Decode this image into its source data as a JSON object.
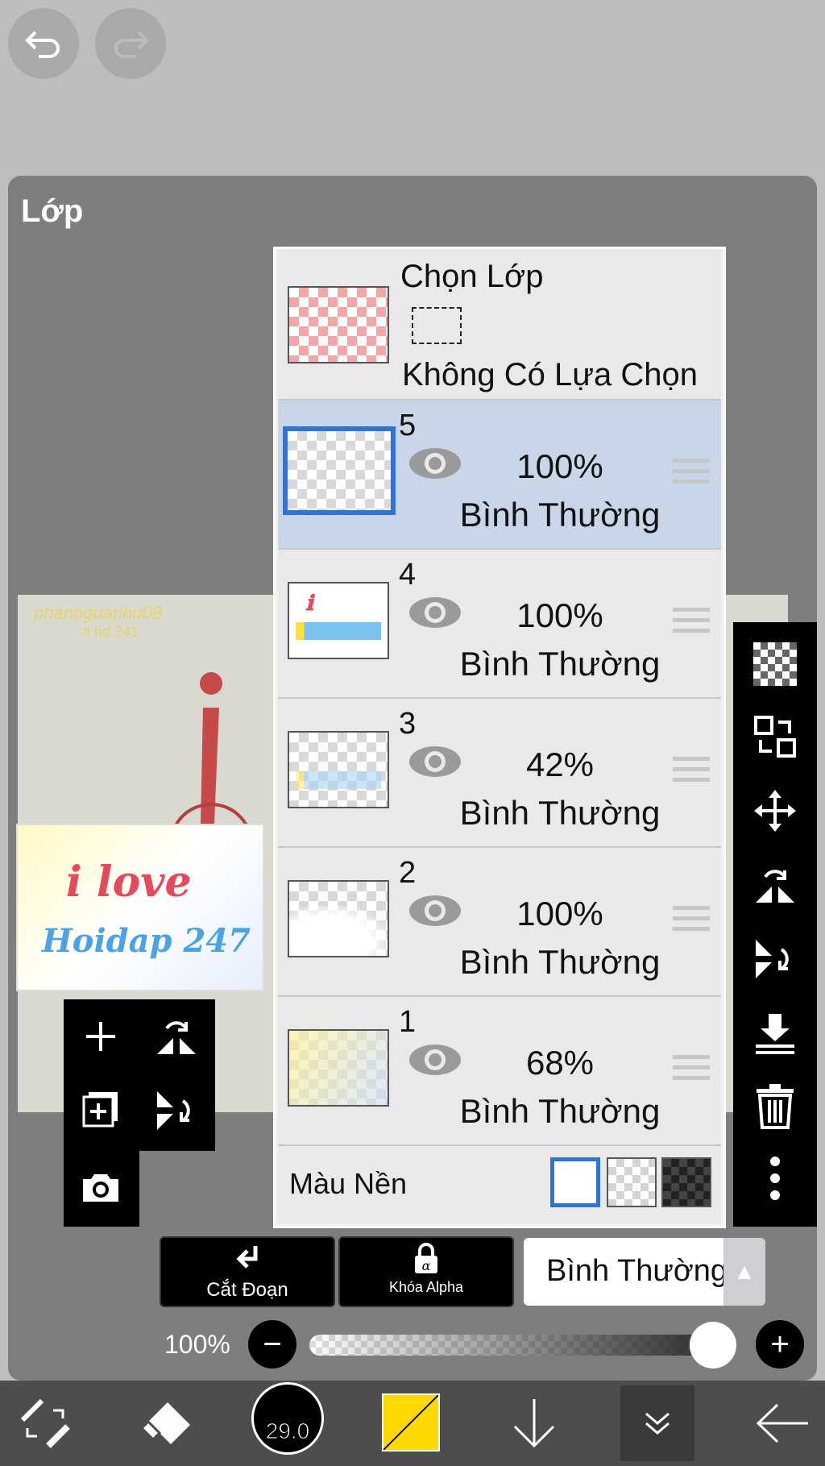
{
  "panel": {
    "title": "Lớp"
  },
  "selection": {
    "title": "Chọn Lớp",
    "status": "Không Có Lựa Chọn"
  },
  "layers": [
    {
      "number": "5",
      "opacity": "100%",
      "mode": "Bình Thường",
      "selected": true
    },
    {
      "number": "4",
      "opacity": "100%",
      "mode": "Bình Thường",
      "selected": false
    },
    {
      "number": "3",
      "opacity": "42%",
      "mode": "Bình Thường",
      "selected": false
    },
    {
      "number": "2",
      "opacity": "100%",
      "mode": "Bình Thường",
      "selected": false
    },
    {
      "number": "1",
      "opacity": "68%",
      "mode": "Bình Thường",
      "selected": false
    }
  ],
  "background_color": {
    "label": "Màu Nền"
  },
  "buttons": {
    "clipping": "Cắt Đoạn",
    "alpha_lock": "Khóa Alpha",
    "blend_mode": "Bình Thường"
  },
  "opacity_slider": {
    "label": "100%",
    "value": 1.0
  },
  "brush": {
    "size": "29.0"
  },
  "canvas_preview": {
    "watermark": "phanbguanhu08",
    "watermark2": "# hd 241",
    "text1": "i love",
    "text2": "Hoidap 247"
  },
  "colors": {
    "accent": "#2f73d8",
    "primary_color": "#ffd800"
  }
}
